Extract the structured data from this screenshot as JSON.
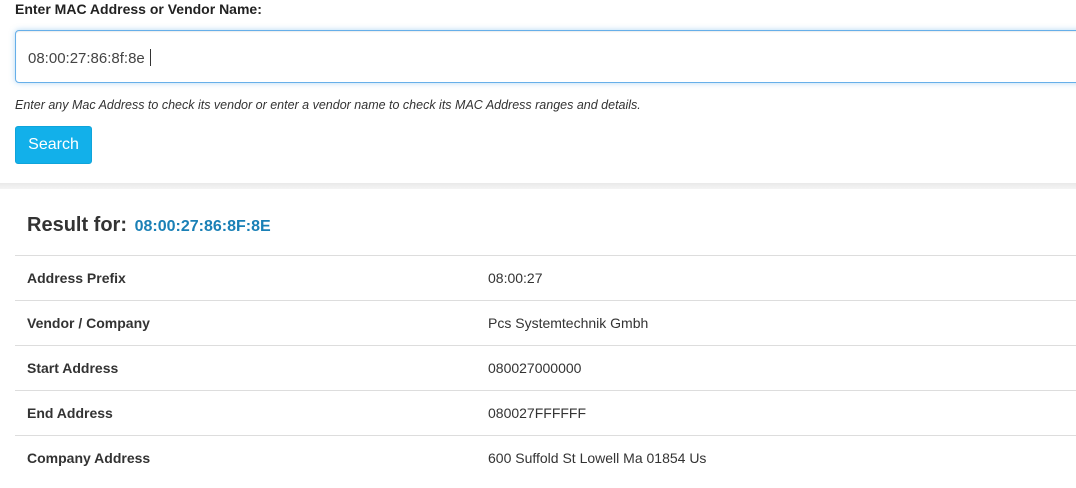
{
  "search": {
    "label": "Enter MAC Address or Vendor Name:",
    "value": "08:00:27:86:8f:8e",
    "help": "Enter any Mac Address to check its vendor or enter a vendor name to check its MAC Address ranges and details.",
    "button_label": "Search"
  },
  "result": {
    "title": "Result for:",
    "mac": "08:00:27:86:8F:8E",
    "rows": [
      {
        "label": "Address Prefix",
        "value": "08:00:27"
      },
      {
        "label": "Vendor / Company",
        "value": "Pcs Systemtechnik Gmbh"
      },
      {
        "label": "Start Address",
        "value": "080027000000"
      },
      {
        "label": "End Address",
        "value": "080027FFFFFF"
      },
      {
        "label": "Company Address",
        "value": "600 Suffold St Lowell Ma 01854 Us"
      }
    ]
  },
  "colors": {
    "accent": "#12b0ea",
    "link": "#1a80b6",
    "focus_border": "#66afe9"
  }
}
